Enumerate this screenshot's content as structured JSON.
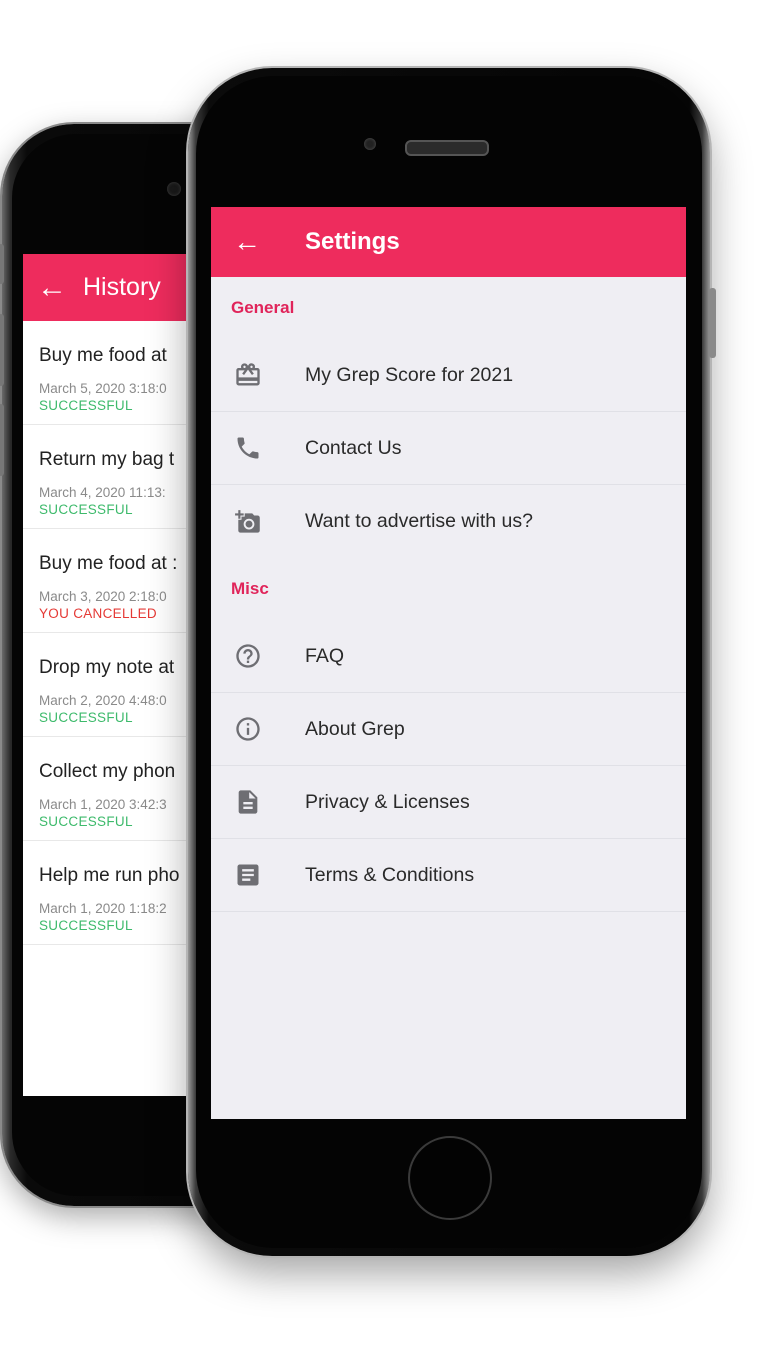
{
  "history": {
    "title": "History",
    "items": [
      {
        "title": "Buy me food at",
        "date": "March 5, 2020 3:18:0",
        "status": "SUCCESSFUL",
        "status_color": "#3dba6b"
      },
      {
        "title": "Return my bag t",
        "date": "March 4, 2020 11:13:",
        "status": "SUCCESSFUL",
        "status_color": "#3dba6b"
      },
      {
        "title": "Buy me food at :",
        "date": "March 3, 2020 2:18:0",
        "status": "YOU CANCELLED",
        "status_color": "#e53935"
      },
      {
        "title": "Drop my note at",
        "date": "March 2, 2020 4:48:0",
        "status": "SUCCESSFUL",
        "status_color": "#3dba6b"
      },
      {
        "title": "Collect my phon",
        "date": "March 1, 2020 3:42:3",
        "status": "SUCCESSFUL",
        "status_color": "#3dba6b"
      },
      {
        "title": "Help me run pho",
        "date": "March 1, 2020 1:18:2",
        "status": "SUCCESSFUL",
        "status_color": "#3dba6b"
      }
    ]
  },
  "settings": {
    "title": "Settings",
    "accent_color": "#ee2c5d",
    "section_color": "#e0245a",
    "sections": [
      {
        "header": "General",
        "items": [
          {
            "label": "My Grep Score for 2021",
            "icon": "gift-card-icon"
          },
          {
            "label": "Contact Us",
            "icon": "phone-icon"
          },
          {
            "label": "Want to advertise with us?",
            "icon": "add-camera-icon"
          }
        ]
      },
      {
        "header": "Misc",
        "items": [
          {
            "label": "FAQ",
            "icon": "help-circle-icon"
          },
          {
            "label": "About Grep",
            "icon": "info-icon"
          },
          {
            "label": "Privacy & Licenses",
            "icon": "document-icon"
          },
          {
            "label": "Terms & Conditions",
            "icon": "notes-icon"
          }
        ]
      }
    ]
  }
}
